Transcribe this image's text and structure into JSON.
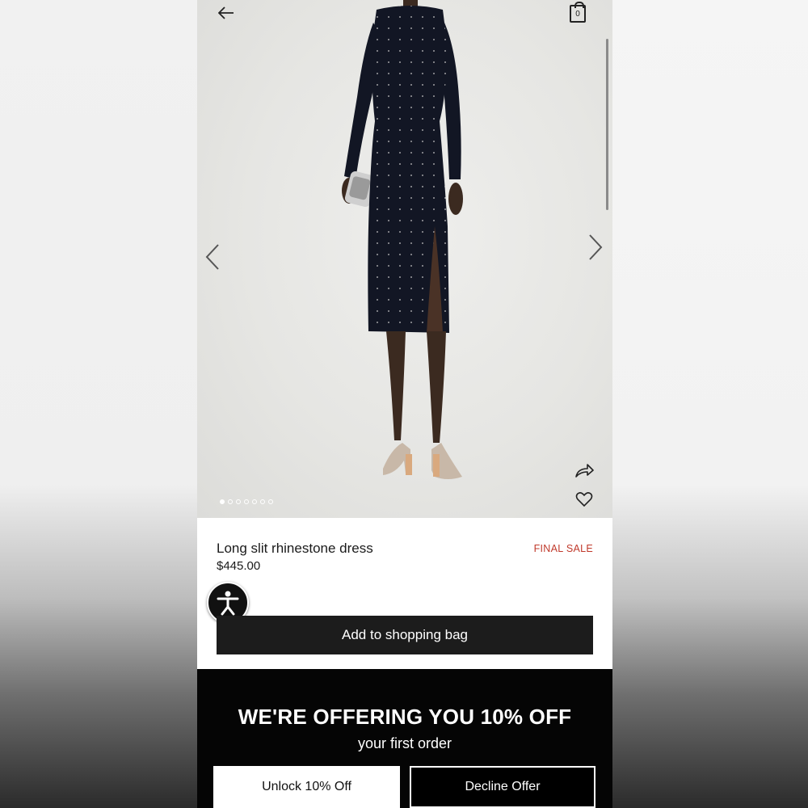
{
  "header": {
    "cart_count": "0"
  },
  "product": {
    "title": "Long slit rhinestone dress",
    "price": "$445.00",
    "badge": "FINAL SALE",
    "badge_color": "#c0392b",
    "add_to_bag_label": "Add to shopping bag",
    "image_count": 7,
    "active_image": 1
  },
  "promo": {
    "title": "WE'RE OFFERING YOU 10% OFF",
    "subtitle": "your first order",
    "unlock_label": "Unlock 10% Off",
    "decline_label": "Decline Offer"
  },
  "icons": [
    "back-arrow-icon",
    "shopping-bag-icon",
    "chevron-left-icon",
    "chevron-right-icon",
    "share-icon",
    "heart-icon",
    "accessibility-icon"
  ]
}
